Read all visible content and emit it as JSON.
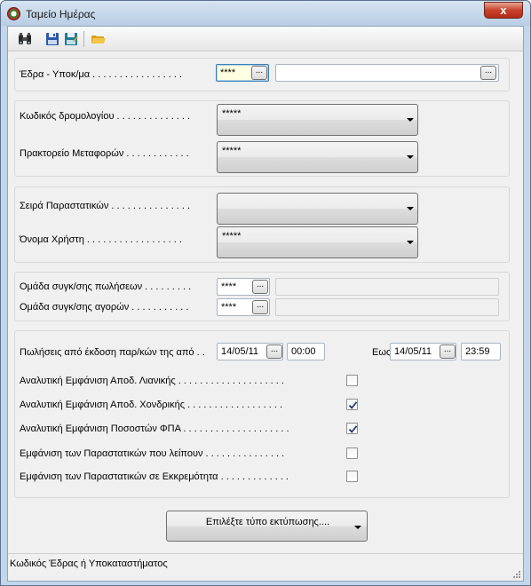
{
  "window": {
    "title": "Ταμείο Ημέρας",
    "close_glyph": "x"
  },
  "toolbar": {
    "icons": [
      "binoculars-icon",
      "save-icon",
      "save-as-icon",
      "open-folder-icon"
    ]
  },
  "fields": {
    "edra": {
      "label": "Έδρα - Υποκ/μα . . . . . . . . . . . . . . . . .",
      "code": "****",
      "name": ""
    },
    "kodikos_dromologiou": {
      "label": "Κωδικός δρομολογίου . . . . . . . . . . . . . .",
      "value": "*****"
    },
    "praktoreio": {
      "label": "Πρακτορείο Μεταφορών . . . . . . . . . . . .",
      "value": "*****"
    },
    "seira": {
      "label": "Σειρά Παραστατικών . . . . . . . . . . . . . . .",
      "value": ""
    },
    "onoma_xristi": {
      "label": "Όνομα Χρήστη . . . . . . . . . . . . . . . . . .",
      "value": "*****"
    },
    "omada_poliseon": {
      "label": "Ομάδα συγκ/σης πωλήσεων . . . . . . . . .",
      "code": "****",
      "name": ""
    },
    "omada_agoron": {
      "label": "Ομάδα συγκ/σης αγορών . . . . . . . . . . .",
      "code": "****",
      "name": ""
    }
  },
  "dates": {
    "label": "Πωλήσεις από έκδοση παρ/κών της από . .",
    "from_date": "14/05/11",
    "from_time": "00:00",
    "to_label": "Εως",
    "to_date": "14/05/11",
    "to_time": "23:59",
    "ellipsis": "..."
  },
  "options": [
    {
      "label": "Αναλυτική Εμφάνιση Αποδ. Λιανικής . . . . . . . . . . . . . . . . . . . .",
      "checked": false
    },
    {
      "label": "Αναλυτική Εμφάνιση Αποδ. Χονδρικής . . . . . . . . . . . . . . . . . .",
      "checked": true
    },
    {
      "label": "Αναλυτική Εμφάνιση Ποσοστών ΦΠΑ . . . . . . . . . . . . . . . . . . . .",
      "checked": true
    },
    {
      "label": "Εμφάνιση των Παραστατικών που λείπουν . . . . . . . . . . . . . . .",
      "checked": false
    },
    {
      "label": "Εμφάνιση των Παραστατικών σε Εκκρεμότητα . . . . . . . . . . . . .",
      "checked": false
    }
  ],
  "print_button": {
    "label": "Επιλέξτε τύπο εκτύπωσης...."
  },
  "status_bar": {
    "text": "Κωδικός Έδρας ή Υποκαταστήματος"
  }
}
